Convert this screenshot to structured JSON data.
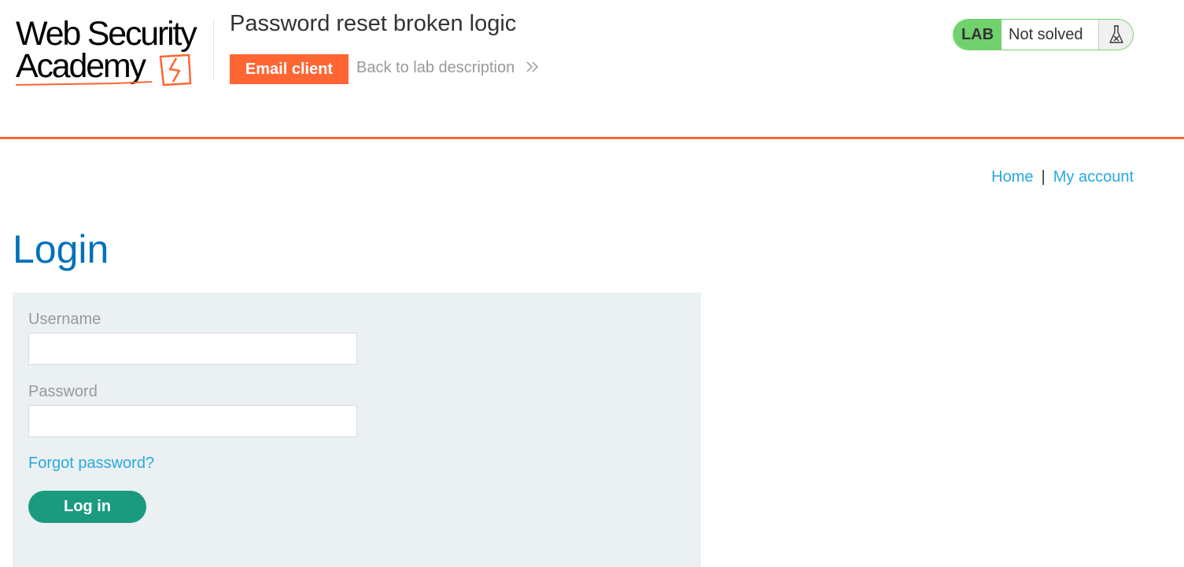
{
  "logo": {
    "line1": "Web Security",
    "line2": "Academy",
    "icon": "academy-lightning-logo-icon"
  },
  "lab": {
    "title": "Password reset broken logic",
    "email_client_label": "Email client",
    "back_link_label": "Back to lab description",
    "back_icon": "double-chevron-right-icon",
    "status_tag": "LAB",
    "status_text": "Not solved",
    "status_icon": "flask-icon"
  },
  "nav": {
    "home_label": "Home",
    "separator": "|",
    "account_label": "My account"
  },
  "login": {
    "heading": "Login",
    "username_label": "Username",
    "username_value": "",
    "password_label": "Password",
    "password_value": "",
    "forgot_label": "Forgot password?",
    "submit_label": "Log in"
  },
  "colors": {
    "accent_orange": "#ff6633",
    "status_green": "#70d16d",
    "link_blue": "#29a9df",
    "heading_blue": "#0071bc",
    "button_teal": "#1a9b80",
    "panel_bg": "#ebf0f2"
  }
}
